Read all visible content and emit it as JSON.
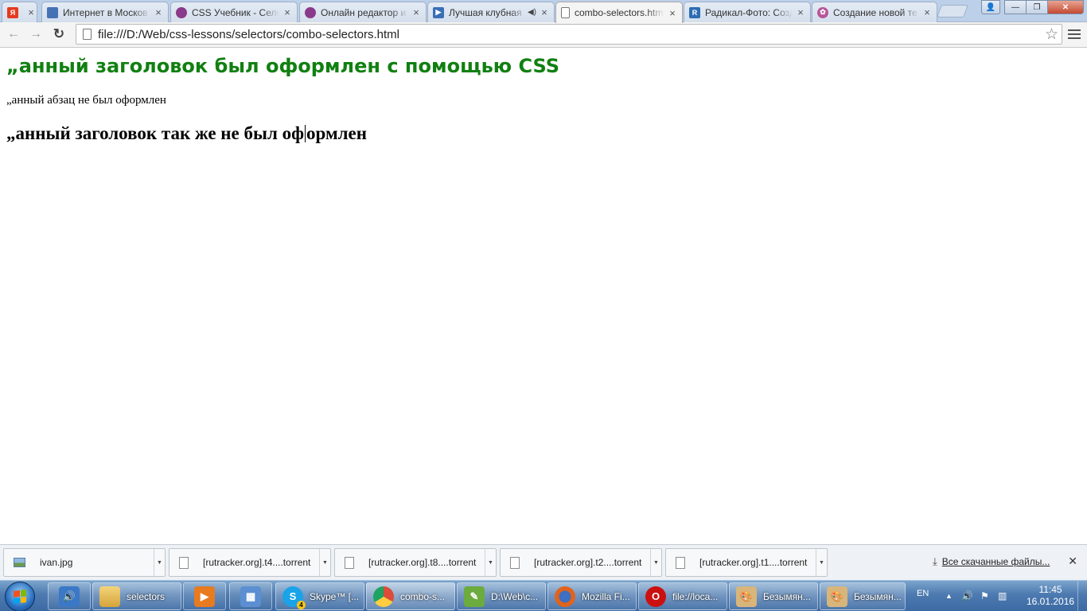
{
  "tabs": [
    {
      "title": "",
      "favicon": "yandex-icon",
      "color": "#e53a1f",
      "glyph": "Я",
      "close": "×",
      "active": false
    },
    {
      "title": "Интернет в Москов",
      "favicon": "python-icon",
      "color": "#4472b5",
      "glyph": "",
      "close": "×",
      "active": false
    },
    {
      "title": "CSS Учебник - Селе",
      "favicon": "site-icon",
      "color": "#8a3a8a",
      "glyph": "",
      "close": "×",
      "active": false
    },
    {
      "title": "Онлайн редактор и",
      "favicon": "site-icon",
      "color": "#8a3a8a",
      "glyph": "",
      "close": "×",
      "active": false
    },
    {
      "title": "Лучшая клубная",
      "favicon": "play-icon",
      "color": "#3a6fb5",
      "glyph": "▶",
      "close": "×",
      "speaker": "◀)",
      "active": false
    },
    {
      "title": "combo-selectors.htm",
      "favicon": "page-icon",
      "color": "#ffffff",
      "glyph": "",
      "close": "×",
      "active": true
    },
    {
      "title": "Радикал-Фото: Созд",
      "favicon": "radikal-icon",
      "color": "#2d6db3",
      "glyph": "R",
      "close": "×",
      "active": false
    },
    {
      "title": "Создание новой те",
      "favicon": "flower-icon",
      "color": "#b8559a",
      "glyph": "✿",
      "close": "×",
      "active": false
    }
  ],
  "window_buttons": {
    "user": "👤",
    "minimize": "—",
    "maximize": "❐",
    "close": "✕"
  },
  "toolbar": {
    "back": "←",
    "forward": "→",
    "reload": "↻",
    "url": "file:///D:/Web/css-lessons/selectors/combo-selectors.html",
    "star": "☆"
  },
  "page": {
    "heading1": "„анный заголовок был оформлен с помощью CSS",
    "heading1_color": "#118011",
    "paragraph": "„анный абзац не был оформлен",
    "heading2_before_cursor": "„анный заголовок так же не был оф",
    "heading2_after_cursor": "ормлен"
  },
  "downloads": {
    "items": [
      {
        "name": "ivan.jpg",
        "icon": "image-file-icon"
      },
      {
        "name": "[rutracker.org].t4....torrent",
        "icon": "file-icon"
      },
      {
        "name": "[rutracker.org].t8....torrent",
        "icon": "file-icon"
      },
      {
        "name": "[rutracker.org].t2....torrent",
        "icon": "file-icon"
      },
      {
        "name": "[rutracker.org].t1....torrent",
        "icon": "file-icon"
      }
    ],
    "dropdown": "▼",
    "all_downloads": "Все скачанные файлы...",
    "all_icon": "⤓",
    "close": "✕"
  },
  "taskbar": {
    "items": [
      {
        "label": "",
        "icon": "volume-icon",
        "color": "#3b78c6",
        "glyph": "🔊",
        "pinned": true
      },
      {
        "label": "selectors",
        "icon": "folder-icon",
        "color": "#e8c35a",
        "glyph": "",
        "pinned": false
      },
      {
        "label": "",
        "icon": "media-player-icon",
        "color": "#e87a1f",
        "glyph": "▶",
        "pinned": true
      },
      {
        "label": "",
        "icon": "control-panel-icon",
        "color": "#5b8fd1",
        "glyph": "▦",
        "pinned": true
      },
      {
        "label": "Skype™ [...",
        "icon": "skype-icon",
        "color": "#1aa3e8",
        "glyph": "S",
        "pinned": false
      },
      {
        "label": "combo-s...",
        "icon": "chrome-icon",
        "color": "#dd4b39",
        "glyph": "◉",
        "pinned": false
      },
      {
        "label": "D:\\Web\\c...",
        "icon": "notepad-icon",
        "color": "#6cab3d",
        "glyph": "✎",
        "pinned": false
      },
      {
        "label": "Mozilla Fi...",
        "icon": "firefox-icon",
        "color": "#e2631a",
        "glyph": "◐",
        "pinned": false
      },
      {
        "label": "file://loca...",
        "icon": "opera-icon",
        "color": "#cc1010",
        "glyph": "O",
        "pinned": false
      },
      {
        "label": "Безымян...",
        "icon": "paint-icon",
        "color": "#c8a060",
        "glyph": "🎨",
        "pinned": false
      },
      {
        "label": "Безымян...",
        "icon": "paint-icon",
        "color": "#c8a060",
        "glyph": "🎨",
        "pinned": false
      }
    ],
    "skype_badge": "4",
    "tray": {
      "lang": "EN",
      "up_arrow": "▲",
      "volume": "🔊",
      "flag": "⚑",
      "network": "▥",
      "time": "11:45",
      "date": "16.01.2016"
    }
  }
}
